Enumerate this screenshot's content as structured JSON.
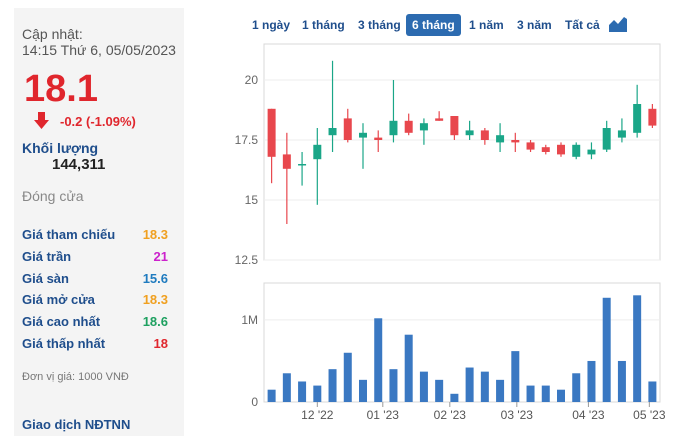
{
  "info": {
    "update_label": "Cập nhật:",
    "update_time": "14:15 Thứ 6, 05/05/2023",
    "price": "18.1",
    "change": "-0.2 (-1.09%)",
    "volume_label": "Khối lượng",
    "volume_value": "144,311",
    "close_label": "Đóng cửa",
    "rows": [
      {
        "label": "Giá tham chiếu",
        "value": "18.3",
        "color": "#f0a020"
      },
      {
        "label": "Giá trần",
        "value": "21",
        "color": "#cc22cc"
      },
      {
        "label": "Giá sàn",
        "value": "15.6",
        "color": "#1f7bbf"
      },
      {
        "label": "Giá mở cửa",
        "value": "18.3",
        "color": "#f0a020"
      },
      {
        "label": "Giá cao nhất",
        "value": "18.6",
        "color": "#1ea060"
      },
      {
        "label": "Giá thấp nhất",
        "value": "18",
        "color": "#e0262d"
      }
    ],
    "unit_note": "Đơn vị giá: 1000 VNĐ",
    "foreign_link": "Giao dịch NĐTNN"
  },
  "tabs": [
    "1 ngày",
    "1 tháng",
    "3 tháng",
    "6 tháng",
    "1 năm",
    "3 năm",
    "Tất cả"
  ],
  "active_tab": "6 tháng",
  "colors": {
    "up": "#1aa688",
    "down": "#e8474d",
    "volume": "#3a78c2",
    "accent": "#1f4e8c"
  },
  "chart_data": [
    {
      "type": "candlestick",
      "y_ticks": [
        "20",
        "17.5",
        "15",
        "12.5"
      ],
      "ylim": [
        12.5,
        21.5
      ],
      "candles": [
        {
          "o": 18.8,
          "h": 18.8,
          "l": 15.7,
          "c": 16.8
        },
        {
          "o": 16.9,
          "h": 17.8,
          "l": 14.0,
          "c": 16.3
        },
        {
          "o": 16.5,
          "h": 17.0,
          "l": 15.6,
          "c": 16.5
        },
        {
          "o": 16.7,
          "h": 18.0,
          "l": 14.8,
          "c": 17.3
        },
        {
          "o": 17.7,
          "h": 20.8,
          "l": 17.0,
          "c": 18.0
        },
        {
          "o": 18.4,
          "h": 18.8,
          "l": 17.4,
          "c": 17.5
        },
        {
          "o": 17.6,
          "h": 18.2,
          "l": 16.3,
          "c": 17.8
        },
        {
          "o": 17.6,
          "h": 17.9,
          "l": 17.0,
          "c": 17.5
        },
        {
          "o": 17.7,
          "h": 20.0,
          "l": 17.4,
          "c": 18.3
        },
        {
          "o": 18.3,
          "h": 18.6,
          "l": 17.7,
          "c": 17.8
        },
        {
          "o": 17.9,
          "h": 18.4,
          "l": 17.3,
          "c": 18.2
        },
        {
          "o": 18.4,
          "h": 18.7,
          "l": 18.3,
          "c": 18.3
        },
        {
          "o": 18.5,
          "h": 18.5,
          "l": 17.5,
          "c": 17.7
        },
        {
          "o": 17.7,
          "h": 18.3,
          "l": 17.5,
          "c": 17.9
        },
        {
          "o": 17.9,
          "h": 18.0,
          "l": 17.3,
          "c": 17.5
        },
        {
          "o": 17.4,
          "h": 18.2,
          "l": 17.0,
          "c": 17.7
        },
        {
          "o": 17.5,
          "h": 17.8,
          "l": 17.0,
          "c": 17.4
        },
        {
          "o": 17.4,
          "h": 17.5,
          "l": 17.0,
          "c": 17.1
        },
        {
          "o": 17.2,
          "h": 17.3,
          "l": 16.9,
          "c": 17.0
        },
        {
          "o": 17.3,
          "h": 17.4,
          "l": 16.8,
          "c": 16.9
        },
        {
          "o": 16.8,
          "h": 17.4,
          "l": 16.7,
          "c": 17.3
        },
        {
          "o": 16.9,
          "h": 17.4,
          "l": 16.7,
          "c": 17.1
        },
        {
          "o": 17.1,
          "h": 18.3,
          "l": 17.0,
          "c": 18.0
        },
        {
          "o": 17.6,
          "h": 18.4,
          "l": 17.4,
          "c": 17.9
        },
        {
          "o": 17.8,
          "h": 19.8,
          "l": 17.6,
          "c": 19.0
        },
        {
          "o": 18.8,
          "h": 19.0,
          "l": 18.0,
          "c": 18.1
        }
      ]
    },
    {
      "type": "bar",
      "y_ticks": [
        "1M",
        "0"
      ],
      "ylim": [
        0,
        1.45
      ],
      "x_ticks": [
        "12 '22",
        "01 '23",
        "02 '23",
        "03 '23",
        "04 '23",
        "05 '23"
      ],
      "x_tick_index": [
        3.5,
        7.8,
        12.2,
        16.6,
        21.3,
        25.3
      ],
      "values": [
        0.15,
        0.35,
        0.25,
        0.2,
        0.4,
        0.6,
        0.27,
        1.02,
        0.4,
        0.82,
        0.37,
        0.27,
        0.1,
        0.42,
        0.37,
        0.27,
        0.62,
        0.2,
        0.2,
        0.15,
        0.35,
        0.5,
        1.27,
        0.5,
        1.3,
        0.25
      ]
    }
  ]
}
